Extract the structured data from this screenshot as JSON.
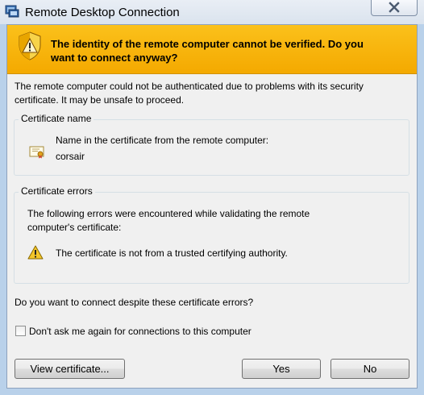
{
  "window": {
    "title": "Remote Desktop Connection",
    "close_icon": "close-x",
    "title_icon": "remote-desktop-icon"
  },
  "banner": {
    "icon": "shield-warning-icon",
    "line1": "The identity of the remote computer cannot be verified. Do you",
    "line2": "want to connect anyway?",
    "accent_color": "#f4a900"
  },
  "intro": {
    "line1": "The remote computer could not be authenticated due to problems with its security",
    "line2": "certificate. It may be unsafe to proceed."
  },
  "certificate_name": {
    "label": "Certificate name",
    "icon": "certificate-icon",
    "description": "Name in the certificate from the remote computer:",
    "value": "corsair"
  },
  "certificate_errors": {
    "label": "Certificate errors",
    "intro_line1": "The following errors were encountered while validating the remote",
    "intro_line2": "computer's certificate:",
    "icon": "warning-icon",
    "error": "The certificate is not from a trusted certifying authority."
  },
  "question": "Do you want to connect despite these certificate errors?",
  "dont_ask": {
    "label": "Don't ask me again for connections to this computer",
    "checked": false
  },
  "buttons": {
    "view_certificate": "View certificate...",
    "yes": "Yes",
    "no": "No"
  }
}
